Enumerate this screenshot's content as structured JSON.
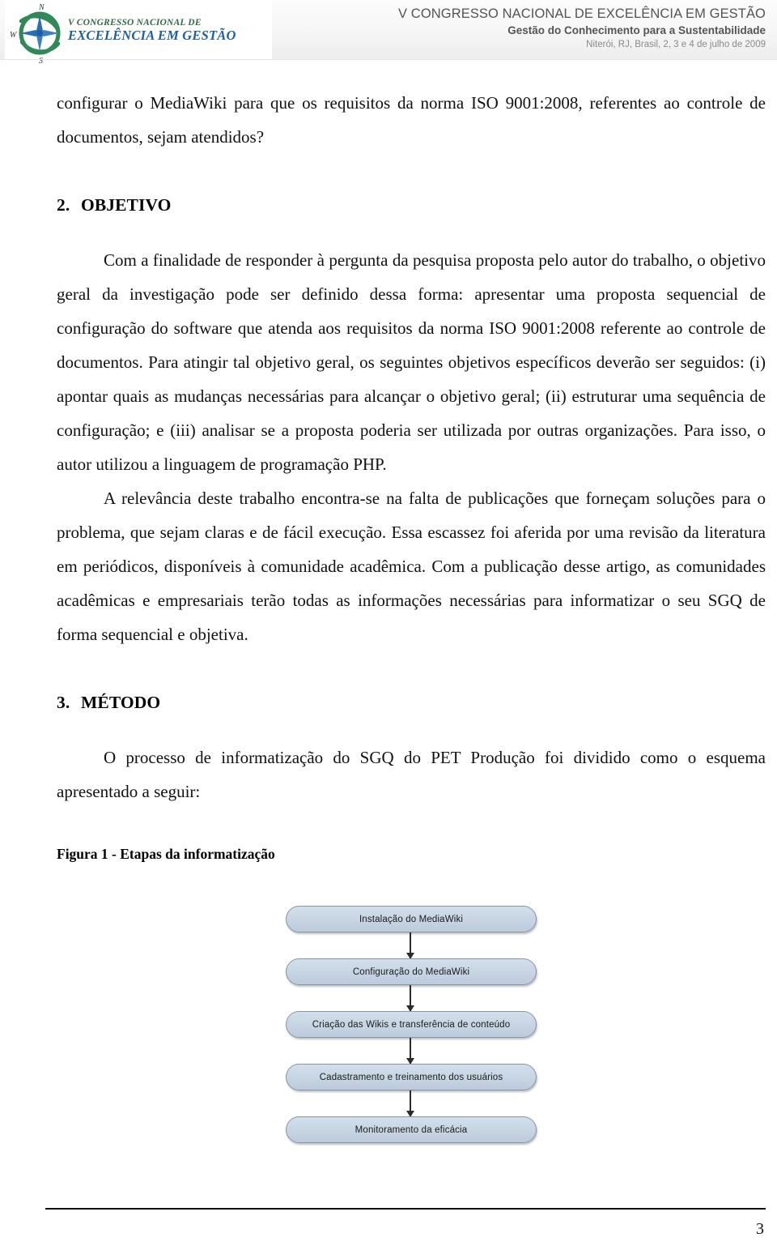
{
  "header": {
    "logo": {
      "icon": "compass-rose-icon",
      "cardinal_n": "N",
      "cardinal_s": "S",
      "cardinal_w": "W",
      "line1": "V CONGRESSO NACIONAL DE",
      "line2": "EXCELÊNCIA EM GESTÃO",
      "green": "#2f6b45",
      "blue": "#1f5fa0"
    },
    "title": "V CONGRESSO NACIONAL DE EXCELÊNCIA EM GESTÃO",
    "subtitle": "Gestão do Conhecimento para a Sustentabilidade",
    "date_line": "Niterói, RJ, Brasil, 2, 3 e 4 de julho de 2009"
  },
  "body": {
    "continued_paragraph": "configurar o MediaWiki para que os requisitos da norma ISO 9001:2008, referentes ao controle de documentos, sejam atendidos?",
    "section_2": {
      "number": "2.",
      "title": "OBJETIVO",
      "paragraph_1": "Com a finalidade de responder à pergunta da pesquisa proposta pelo autor do trabalho, o objetivo geral da investigação pode ser definido dessa forma: apresentar uma proposta sequencial de configuração do software que atenda aos requisitos da norma ISO 9001:2008 referente ao controle de documentos. Para atingir tal objetivo geral, os seguintes objetivos específicos deverão ser seguidos: (i) apontar quais as mudanças necessárias para alcançar o objetivo geral; (ii) estruturar uma sequência de configuração; e (iii) analisar se a proposta poderia ser utilizada por outras organizações. Para isso, o autor utilizou a linguagem de programação PHP.",
      "paragraph_2": "A relevância deste trabalho encontra-se na falta de publicações que forneçam soluções para o problema, que sejam claras e de fácil execução. Essa escassez foi aferida por uma revisão da literatura em periódicos, disponíveis à comunidade acadêmica. Com a publicação desse artigo, as comunidades acadêmicas e empresariais terão todas as informações necessárias para informatizar o seu SGQ de forma sequencial e objetiva."
    },
    "section_3": {
      "number": "3.",
      "title": "MÉTODO",
      "paragraph_1": "O processo de informatização do SGQ do PET Produção foi dividido como o esquema apresentado a seguir:"
    },
    "figure_caption": "Figura 1 - Etapas da informatização"
  },
  "flowchart": {
    "steps": [
      {
        "label": "Instalação do MediaWiki"
      },
      {
        "label": "Configuração do MediaWiki"
      },
      {
        "label": "Criação das Wikis e transferência de conteúdo"
      },
      {
        "label": "Cadastramento e treinamento dos usuários"
      },
      {
        "label": "Monitoramento da eficácia"
      }
    ],
    "box_fill": "#c6d4e3",
    "box_border": "#8795a3",
    "arrow_color": "#2b2b2b"
  },
  "footer": {
    "page_number": "3"
  }
}
